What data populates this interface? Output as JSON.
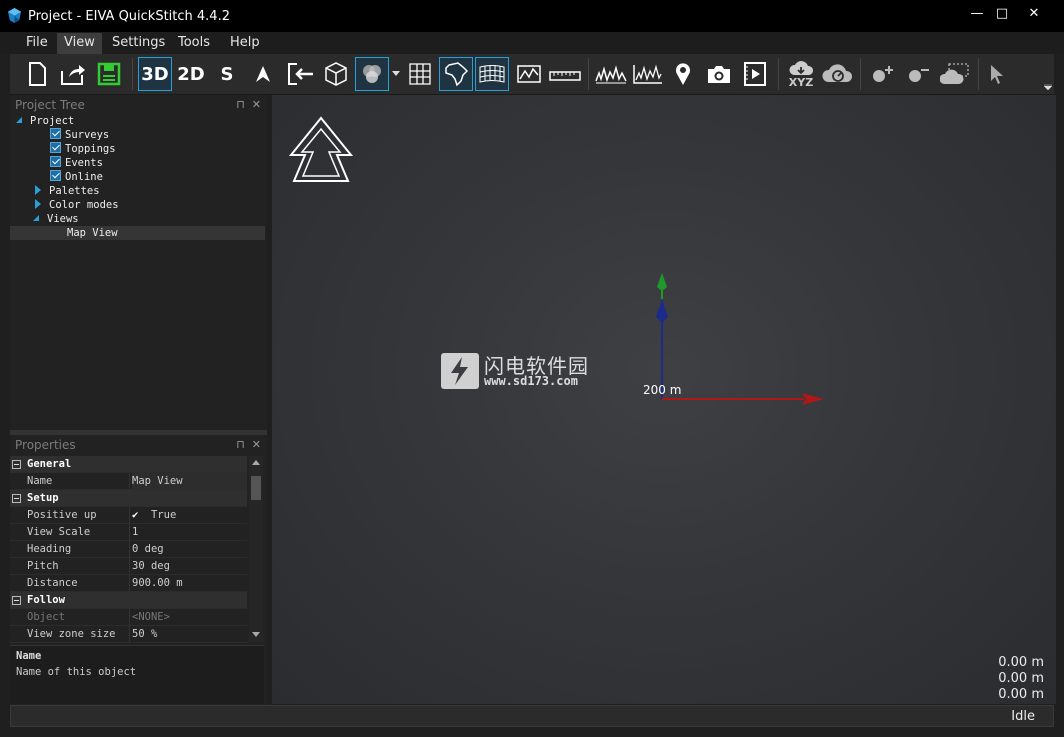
{
  "window": {
    "title": "Project - EIVA QuickStitch 4.4.2",
    "controls": [
      "—",
      "□",
      "✕"
    ]
  },
  "menu": [
    "File",
    "View",
    "Settings",
    "Tools",
    "Help"
  ],
  "toolbar": {
    "view_3d": "3D",
    "view_2d": "2D",
    "view_s": "S",
    "xyz_label": "XYZ"
  },
  "project_tree": {
    "title": "Project Tree",
    "items": {
      "project": "Project",
      "surveys": "Surveys",
      "toppings": "Toppings",
      "events": "Events",
      "online": "Online",
      "palettes": "Palettes",
      "color_modes": "Color modes",
      "views": "Views",
      "map_view": "Map View"
    }
  },
  "properties": {
    "title": "Properties",
    "general": "General",
    "name_label": "Name",
    "name_value": "Map View",
    "setup": "Setup",
    "positive_up_label": "Positive up",
    "positive_up_value": "True",
    "view_scale_label": "View Scale",
    "view_scale_value": "1",
    "heading_label": "Heading",
    "heading_value": "0 deg",
    "pitch_label": "Pitch",
    "pitch_value": "30 deg",
    "distance_label": "Distance",
    "distance_value": "900.00 m",
    "follow": "Follow",
    "object_label": "Object",
    "object_value": "<NONE>",
    "view_zone_label": "View zone size",
    "view_zone_value": "50  %",
    "desc_title": "Name",
    "desc_text": "Name of this object"
  },
  "viewport": {
    "scale_label": "200 m",
    "watermark_cn": "闪电软件园",
    "watermark_url": "www.sd173.com",
    "coord_x": "0.00 m",
    "coord_y": "0.00 m",
    "coord_z": "0.00 m"
  },
  "status": {
    "text": "Idle"
  },
  "colors": {
    "accent": "#2a9fd6",
    "axis_x": "#b01818",
    "axis_y": "#1c2a8c",
    "axis_z": "#1f9a2a"
  }
}
